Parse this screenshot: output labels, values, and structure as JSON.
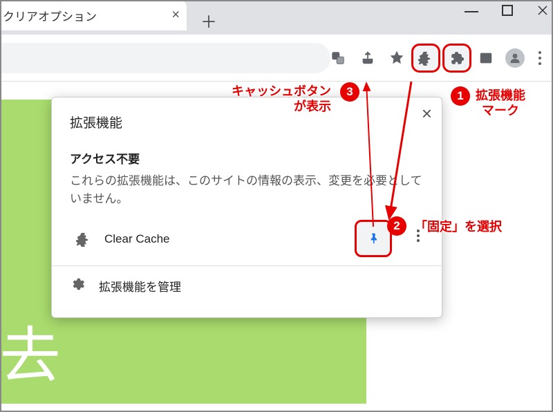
{
  "tab": {
    "title": "クリアオプション"
  },
  "popup": {
    "title": "拡張機能",
    "section_title": "アクセス不要",
    "section_desc": "これらの拡張機能は、このサイトの情報の表示、変更を必要としていません。",
    "extension_name": "Clear Cache",
    "manage_label": "拡張機能を管理"
  },
  "annotations": {
    "a1": "拡張機能\nマーク",
    "a2": "「固定」を選択",
    "a3": "キャッシュボタン\nが表示",
    "n1": "1",
    "n2": "2",
    "n3": "3"
  },
  "bg_text": "i去"
}
